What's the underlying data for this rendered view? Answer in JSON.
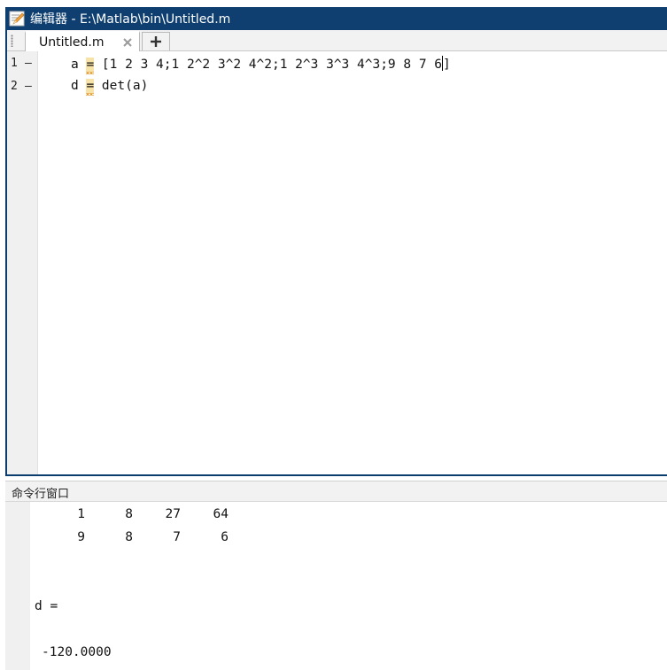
{
  "window": {
    "title": "编辑器 - E:\\Matlab\\bin\\Untitled.m"
  },
  "tabs": [
    {
      "label": "Untitled.m",
      "close_icon": "close-icon"
    }
  ],
  "editor": {
    "lines": [
      {
        "number": "1",
        "marker": "—",
        "var": "a",
        "op": "=",
        "expr": " [1 2 3 4;1 2^2 3^2 4^2;1 2^3 3^3 4^3;9 8 7 6",
        "tail": "]"
      },
      {
        "number": "2",
        "marker": "—",
        "var": "d",
        "op": "=",
        "expr": " det(a)",
        "tail": ""
      }
    ],
    "indent": "    "
  },
  "command_window": {
    "title": "命令行窗口",
    "matrix_rows": [
      [
        "1",
        "8",
        "27",
        "64"
      ],
      [
        "9",
        "8",
        "7",
        "6"
      ]
    ],
    "result_label": "d =",
    "result_value": "-120.0000"
  },
  "colors": {
    "titlebar": "#0e3f70",
    "warning_highlight": "#f7e2a8",
    "warning_squiggle": "#e39a2a"
  }
}
